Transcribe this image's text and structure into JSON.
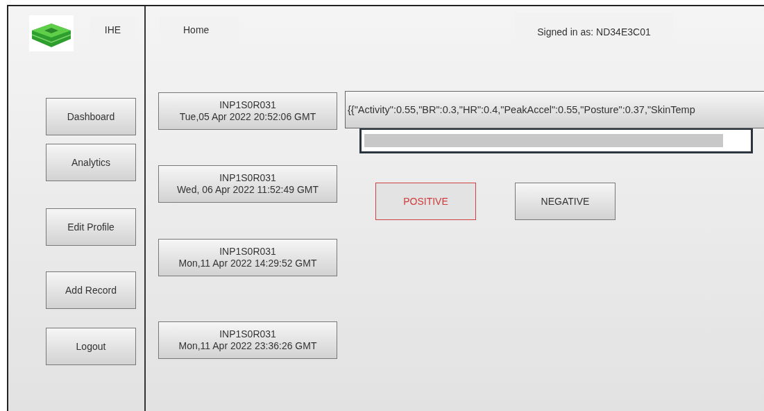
{
  "app": {
    "name": "IHE"
  },
  "header": {
    "page": "Home",
    "signed_in": "Signed in as: ND34E3C01"
  },
  "sidebar": {
    "items": [
      {
        "label": "Dashboard"
      },
      {
        "label": "Analytics"
      },
      {
        "label": "Edit Profile"
      },
      {
        "label": "Add Record"
      },
      {
        "label": "Logout"
      }
    ]
  },
  "records": [
    {
      "id": "INP1S0R031",
      "time": "Tue,05 Apr 2022 20:52:06 GMT"
    },
    {
      "id": "INP1S0R031",
      "time": "Wed, 06 Apr 2022 11:52:49 GMT"
    },
    {
      "id": "INP1S0R031",
      "time": "Mon,11 Apr 2022 14:29:52 GMT"
    },
    {
      "id": "INP1S0R031",
      "time": "Mon,11 Apr 2022 23:36:26 GMT"
    }
  ],
  "payload": "{{\"Activity\":0.55,\"BR\":0.3,\"HR\":0.4,\"PeakAccel\":0.55,\"Posture\":0.37,\"SkinTemp",
  "verdicts": [
    {
      "label": "POSITIVE",
      "selected": true
    },
    {
      "label": "NEGATIVE",
      "selected": false
    }
  ]
}
